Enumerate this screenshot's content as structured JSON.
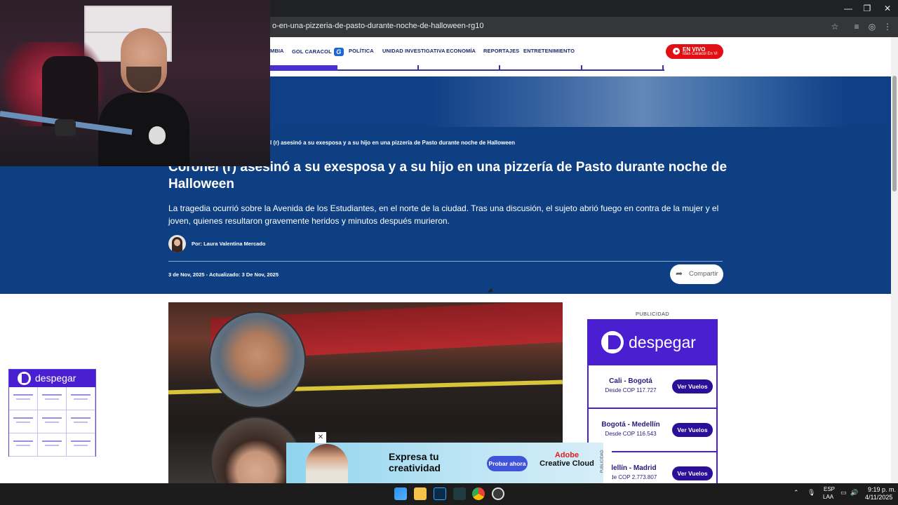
{
  "browser": {
    "url": "o-en-una-pizzeria-de-pasto-durante-noche-de-halloween-rg10",
    "window_controls": [
      "minimize",
      "restore",
      "close"
    ]
  },
  "nav": {
    "items": [
      "MBIA",
      "GOL CARACOL",
      "POLÍTICA",
      "UNIDAD INVESTIGATIVA",
      "ECONOMÍA",
      "REPORTAJES",
      "ENTRETENIMIENTO"
    ],
    "gol_logo": "G",
    "live": {
      "title": "EN VIVO",
      "subtitle": "Ídas Caracol En Vi"
    },
    "progress": 0.17
  },
  "article": {
    "breadcrumb": "l (r) asesinó a su exesposa y a su hijo en una pizzería de Pasto durante noche de Halloween",
    "headline": "Coronel (r) asesinó a su exesposa y a su hijo en una pizzería de Pasto durante noche de Halloween",
    "lede": "La tragedia ocurrió sobre la Avenida de los Estudiantes, en el norte de la ciudad. Tras una discusión, el sujeto abrió fuego en contra de la mujer y el joven, quienes resultaron gravemente heridos y minutos después murieron.",
    "author": "Por: Laura Valentina Mercado",
    "dateline": "3 de Nov, 2025  -  Actualizado: 3 De Nov, 2025",
    "share_label": "Compartir",
    "share_icon": "share-arrow-icon"
  },
  "ads": {
    "publicidad_label": "PUBLICIDAD",
    "right": {
      "brand": "despegar",
      "flights": [
        {
          "route": "Cali - Bogotá",
          "price": "Desde COP 117.727",
          "button": "Ver Vuelos"
        },
        {
          "route": "Bogotá - Medellín",
          "price": "Desde COP 116.543",
          "button": "Ver Vuelos"
        },
        {
          "route": "edellín - Madrid",
          "price": "esde COP 2.773.807",
          "button": "Ver Vuelos"
        }
      ]
    },
    "left": {
      "brand": "despegar"
    },
    "bottom": {
      "headline": "Expresa tu creatividad",
      "button": "Probar ahora",
      "brand_line1": "Adobe",
      "brand_line2": "Creative Cloud",
      "close": "✕",
      "side_label": "PUBLICIDAD"
    }
  },
  "taskbar": {
    "lang_1": "ESP",
    "lang_2": "LAA",
    "time": "9:19 p. m.",
    "date": "4/11/2025"
  },
  "colors": {
    "header_blue": "#0e3f82",
    "accent_purple": "#4a1fd1",
    "live_red": "#e10f14"
  }
}
